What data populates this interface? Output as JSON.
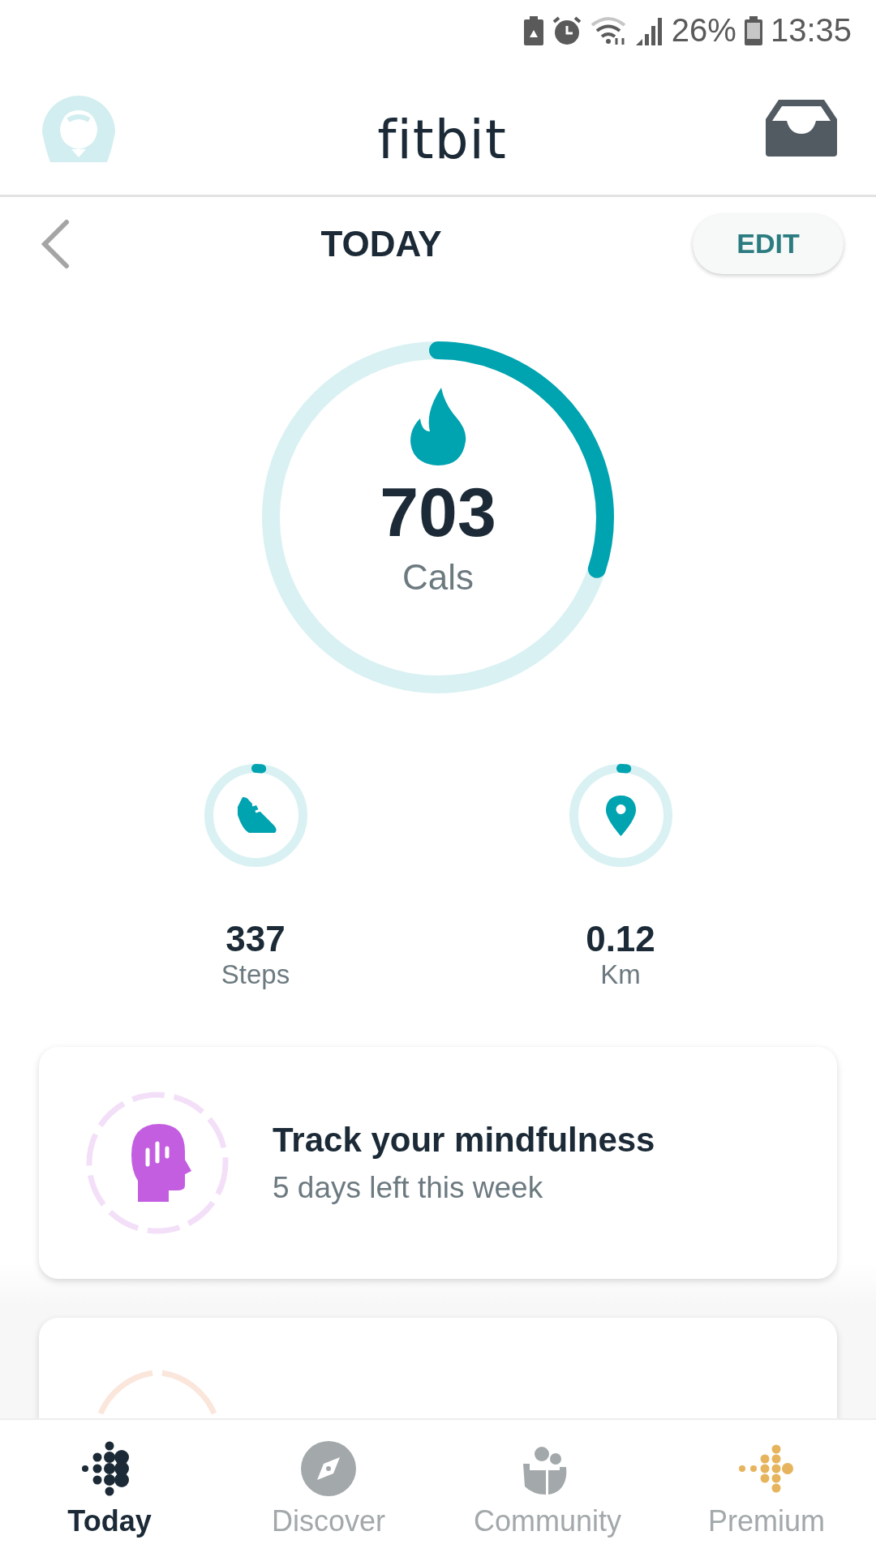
{
  "status_bar": {
    "battery": "26%",
    "time": "13:35"
  },
  "header": {
    "logo": "fitbit"
  },
  "title_bar": {
    "title": "TODAY",
    "edit_button": "EDIT"
  },
  "main_stat": {
    "value": "703",
    "unit": "Cals",
    "level": 0.3
  },
  "stats": [
    {
      "kind": "steps",
      "value": "337",
      "unit": "Steps",
      "level": 0.02
    },
    {
      "kind": "distance",
      "value": "0.12",
      "unit": "Km",
      "level": 0.02
    }
  ],
  "cards": [
    {
      "kind": "mindfulness",
      "title": "Track your mindfulness",
      "subtitle": "5 days left this week"
    }
  ],
  "bottom_nav": [
    {
      "kind": "today",
      "label": "Today",
      "selected": true
    },
    {
      "kind": "discover",
      "label": "Discover",
      "selected": false
    },
    {
      "kind": "community",
      "label": "Community",
      "selected": false
    },
    {
      "kind": "premium",
      "label": "Premium",
      "selected": false
    }
  ]
}
